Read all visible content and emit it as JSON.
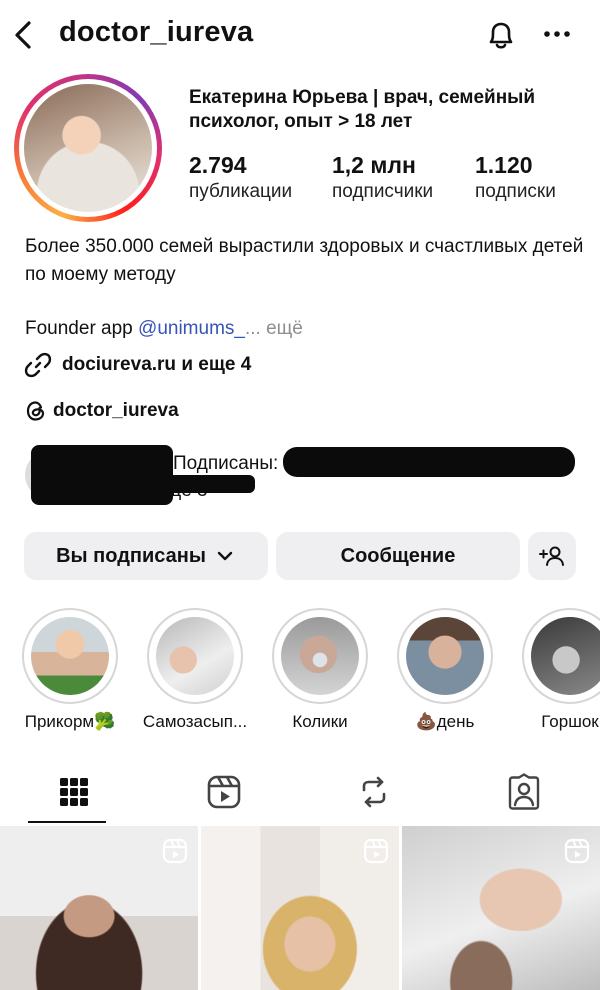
{
  "header": {
    "username": "doctor_iureva"
  },
  "profile": {
    "display_name": "Екатерина Юрьева | врач, семейный психолог, опыт > 18 лет",
    "stats": [
      {
        "value": "2.794",
        "label": "публикации"
      },
      {
        "value": "1,2 млн",
        "label": "подписчики"
      },
      {
        "value": "1.120",
        "label": "подписки"
      }
    ],
    "bio": "Более 350.000 семей вырастили здоровых и счастливых детей по моему методу",
    "founder_prefix": "Founder app ",
    "founder_mention": "@unimums_",
    "founder_more": "... ещё",
    "link_text": "dociureva.ru и еще 4",
    "threads_handle": "doctor_iureva",
    "followed_by_text": "Подписаны: a",
    "followed_by_more": "ещё 3"
  },
  "actions": {
    "following_label": "Вы подписаны",
    "message_label": "Сообщение"
  },
  "highlights": [
    {
      "label": "Прикорм🥦"
    },
    {
      "label": "Самозасып..."
    },
    {
      "label": "Колики"
    },
    {
      "label": "💩день"
    },
    {
      "label": "Горшок"
    }
  ],
  "colors": {
    "accent_link": "#3654b5",
    "button_bg": "#efeff1"
  }
}
